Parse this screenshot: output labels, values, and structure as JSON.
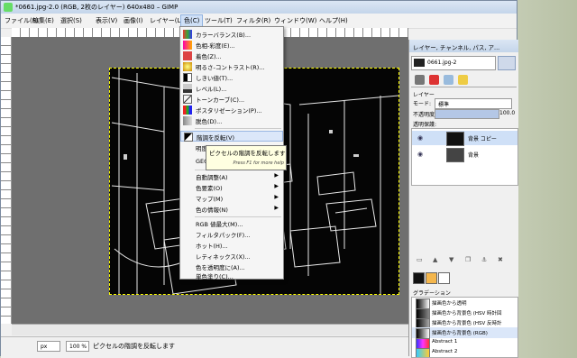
{
  "window": {
    "title": "*0661.jpg-2.0 (RGB, 2枚のレイヤー) 640x480 – GIMP"
  },
  "menubar": {
    "items": [
      "ファイル(F)",
      "編集(E)",
      "選択(S)",
      "表示(V)",
      "画像(I)",
      "レイヤー(L)",
      "色(C)",
      "ツール(T)",
      "フィルタ(R)",
      "ウィンドウ(W)",
      "ヘルプ(H)"
    ]
  },
  "color_menu": {
    "items": [
      "カラーバランス(B)...",
      "色相-彩度(E)...",
      "着色(Z)...",
      "明るさ-コントラスト(R)...",
      "しきい値(T)...",
      "レベル(L)...",
      "トーンカーブ(C)...",
      "ポスタリゼーション(P)...",
      "脱色(D)...",
      "階調を反転(V)",
      "明度",
      "GEG",
      "自動調整(A)",
      "色要素(O)",
      "マップ(M)",
      "色の情報(N)",
      "RGB 値最大(M)...",
      "フィルタパック(F)...",
      "ホット(H)...",
      "レティネックス(X)...",
      "色を透明度に(A)...",
      "単色塗り(C)..."
    ]
  },
  "tooltip": {
    "text": "ピクセルの階調を反転します",
    "hint": "Press F1 for more help"
  },
  "status": {
    "unit": "px",
    "zoom": "100 %",
    "message": "ピクセルの階調を反転します"
  },
  "dock": {
    "title": "レイヤー, チャンネル, パス, ア...",
    "image_selector": "0661.jpg-2",
    "section_label": "レイヤー",
    "mode_label": "モード:",
    "mode_value": "標準",
    "opacity_label": "不透明度",
    "opacity_value": "100.0",
    "lock_label": "透明保護:",
    "layers": [
      "背景 コピー",
      "背景"
    ],
    "gradient_label": "グラデーション",
    "gradients": [
      "描画色から透明",
      "描画色から背景色 (HSV 時計回",
      "描画色から背景色 (HSV 反時計",
      "描画色から背景色 (RGB)",
      "Abstract 1",
      "Abstract 2"
    ]
  },
  "colors": {
    "accent": "#cfe0f7",
    "menu_highlight": "#dbe7f9",
    "tooltip_bg": "#ffffe1"
  }
}
